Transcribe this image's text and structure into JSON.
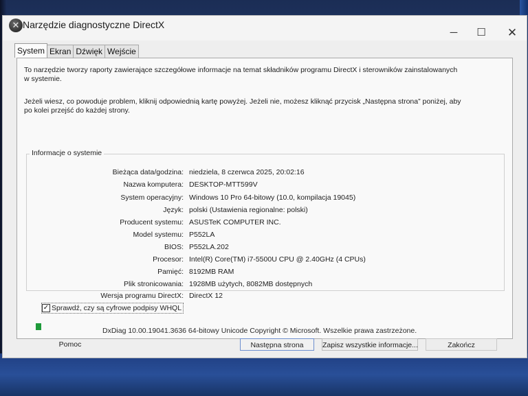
{
  "window": {
    "title": "Narzędzie diagnostyczne DirectX",
    "icon": "directx-icon",
    "controls": {
      "minimize": "─",
      "maximize": "☐",
      "close": "✕"
    }
  },
  "tabs": [
    {
      "label": "System",
      "active": true
    },
    {
      "label": "Ekran",
      "active": false
    },
    {
      "label": "Dźwięk",
      "active": false
    },
    {
      "label": "Wejście",
      "active": false
    }
  ],
  "intro": {
    "paragraph1": "To narzędzie tworzy raporty zawierające szczegółowe informacje na temat składników programu DirectX i sterowników zainstalowanych w systemie.",
    "paragraph2": "Jeżeli wiesz, co powoduje problem, kliknij odpowiednią kartę powyżej. Jeżeli nie, możesz kliknąć przycisk „Następna strona” poniżej, aby po kolei przejść do każdej strony."
  },
  "system_info": {
    "group_label": "Informacje o systemie",
    "rows": [
      {
        "label": "Bieżąca data/godzina:",
        "value": "niedziela, 8 czerwca 2025, 20:02:16"
      },
      {
        "label": "Nazwa komputera:",
        "value": "DESKTOP-MTT599V"
      },
      {
        "label": "System operacyjny:",
        "value": "Windows 10 Pro 64-bitowy (10.0, kompilacja 19045)"
      },
      {
        "label": "Język:",
        "value": "polski (Ustawienia regionalne: polski)"
      },
      {
        "label": "Producent systemu:",
        "value": "ASUSTeK COMPUTER INC."
      },
      {
        "label": "Model systemu:",
        "value": "P552LA"
      },
      {
        "label": "BIOS:",
        "value": "P552LA.202"
      },
      {
        "label": "Procesor:",
        "value": "Intel(R) Core(TM) i7-5500U CPU @ 2.40GHz (4 CPUs)"
      },
      {
        "label": "Pamięć:",
        "value": "8192MB RAM"
      },
      {
        "label": "Plik stronicowania:",
        "value": "1928MB użytych, 8082MB dostępnych"
      },
      {
        "label": "Wersja programu DirectX:",
        "value": "DirectX 12"
      }
    ]
  },
  "whql_check": {
    "label": "Sprawdź, czy są cyfrowe podpisy WHQL",
    "checked": true,
    "mark": "✓"
  },
  "footer": {
    "copyright": "DxDiag 10.00.19041.3636 64-bitowy Unicode  Copyright © Microsoft. Wszelkie prawa zastrzeżone."
  },
  "buttons": {
    "help": "Pomoc",
    "next": "Następna strona",
    "save": "Zapisz wszystkie informacje...",
    "exit": "Zakończ"
  }
}
